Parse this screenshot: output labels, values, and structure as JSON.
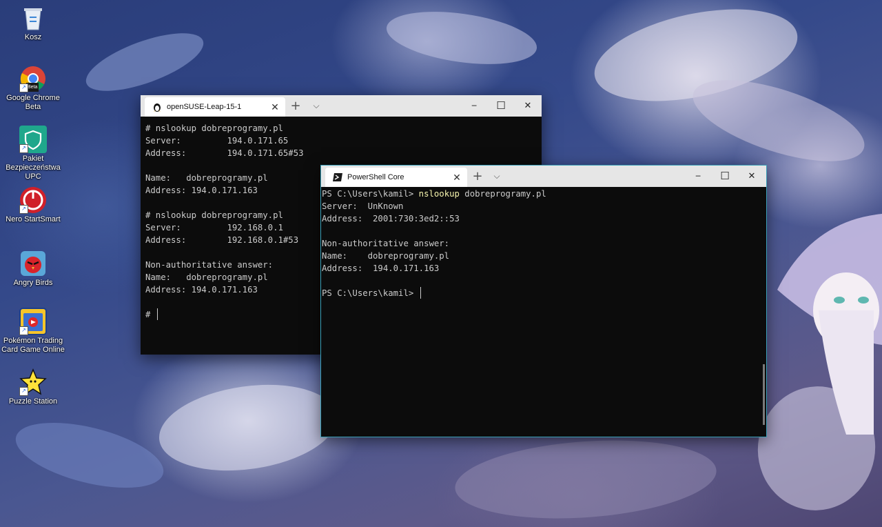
{
  "desktop": {
    "icons": [
      {
        "label": "Kosz",
        "icon": "recycle-bin-icon"
      },
      {
        "label": "Google Chrome Beta",
        "icon": "chrome-beta-icon",
        "badge": "Beta"
      },
      {
        "label": "Pakiet Bezpieczeństwa UPC",
        "icon": "upc-shield-icon"
      },
      {
        "label": "Nero StartSmart",
        "icon": "nero-icon"
      },
      {
        "label": "Angry Birds",
        "icon": "angry-birds-icon"
      },
      {
        "label": "Pokémon Trading Card Game Online",
        "icon": "pokemon-tcg-icon"
      },
      {
        "label": "Puzzle Station",
        "icon": "star-icon"
      }
    ]
  },
  "windows": {
    "opensuse": {
      "tab_title": "openSUSE-Leap-15-1",
      "tab_icon": "tux-icon",
      "lines": [
        "# nslookup dobreprogramy.pl",
        "Server:         194.0.171.65",
        "Address:        194.0.171.65#53",
        "",
        "Name:   dobreprogramy.pl",
        "Address: 194.0.171.163",
        "",
        "# nslookup dobreprogramy.pl",
        "Server:         192.168.0.1",
        "Address:        192.168.0.1#53",
        "",
        "Non-authoritative answer:",
        "Name:   dobreprogramy.pl",
        "Address: 194.0.171.163",
        ""
      ],
      "prompt": "# "
    },
    "powershell": {
      "tab_title": "PowerShell Core",
      "tab_icon": "powershell-icon",
      "prompt_1": "PS C:\\Users\\kamil> ",
      "command": "nslookup",
      "command_args": " dobreprogramy.pl",
      "lines": [
        "Server:  UnKnown",
        "Address:  2001:730:3ed2::53",
        "",
        "Non-authoritative answer:",
        "Name:    dobreprogramy.pl",
        "Address:  194.0.171.163",
        ""
      ],
      "prompt_2": "PS C:\\Users\\kamil> "
    },
    "controls": {
      "new_tab": "+",
      "dropdown": "⌵",
      "minimize": "─",
      "maximize": "☐",
      "close": "✕",
      "tab_close": "✕"
    }
  },
  "colors": {
    "terminal_bg": "#0c0c0c",
    "terminal_fg": "#cccccc",
    "command_yellow": "#f7f5ae",
    "titlebar": "#e6e6e6",
    "active_border": "#3aa0b8"
  }
}
